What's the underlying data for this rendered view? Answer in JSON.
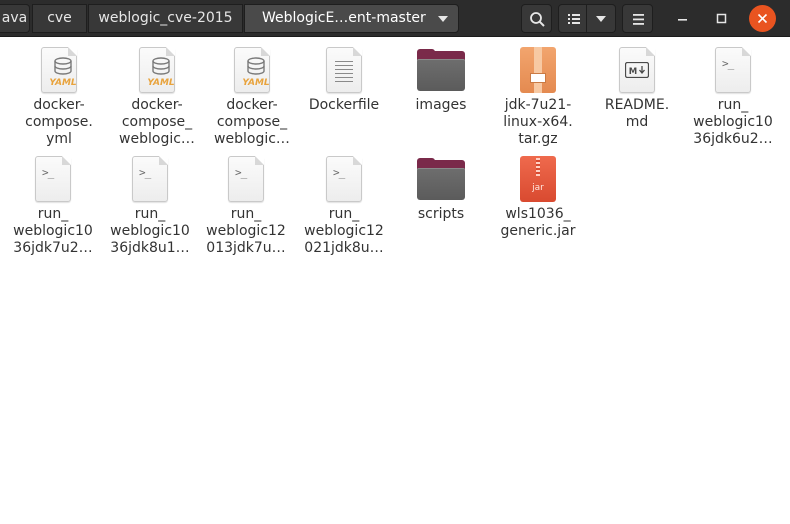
{
  "breadcrumbs": [
    "ava",
    "cve",
    "weblogic_cve-2015",
    "WeblogicE…ent-master"
  ],
  "toolbar": {
    "search_icon": "search-icon",
    "view_icon": "list-view-icon",
    "view_menu_icon": "chevron-down-icon",
    "menu_icon": "hamburger-menu-icon"
  },
  "window_controls": {
    "minimize_icon": "minimize-icon",
    "maximize_icon": "maximize-icon",
    "close_icon": "close-icon"
  },
  "files": [
    {
      "label": "docker-\ncompose.\nyml",
      "icon": "yaml-icon"
    },
    {
      "label": "docker-\ncompose_\nweblogic…",
      "icon": "yaml-icon"
    },
    {
      "label": "docker-\ncompose_\nweblogic…",
      "icon": "yaml-icon"
    },
    {
      "label": "Dockerfile",
      "icon": "text-file-icon"
    },
    {
      "label": "images",
      "icon": "folder-icon"
    },
    {
      "label": "jdk-7u21-\nlinux-x64.\ntar.gz",
      "icon": "archive-icon"
    },
    {
      "label": "README.\nmd",
      "icon": "markdown-icon"
    },
    {
      "label": "run_\nweblogic10\n36jdk6u2…",
      "icon": "script-icon"
    },
    {
      "label": "run_\nweblogic10\n36jdk7u2…",
      "icon": "script-icon"
    },
    {
      "label": "run_\nweblogic10\n36jdk8u1…",
      "icon": "script-icon"
    },
    {
      "label": "run_\nweblogic12\n013jdk7u…",
      "icon": "script-icon"
    },
    {
      "label": "run_\nweblogic12\n021jdk8u…",
      "icon": "script-icon"
    },
    {
      "label": "scripts",
      "icon": "folder-icon"
    },
    {
      "label": "wls1036_\ngeneric.jar",
      "icon": "jar-icon",
      "badge": "jar"
    }
  ],
  "colors": {
    "headerbar": "#2c2c2c",
    "close_button": "#e95420",
    "folder_tab": "#7a2a4a",
    "folder_body": "#626262",
    "archive": "#e8935a",
    "jar": "#e35a3e",
    "yaml": "#e8a33d"
  }
}
